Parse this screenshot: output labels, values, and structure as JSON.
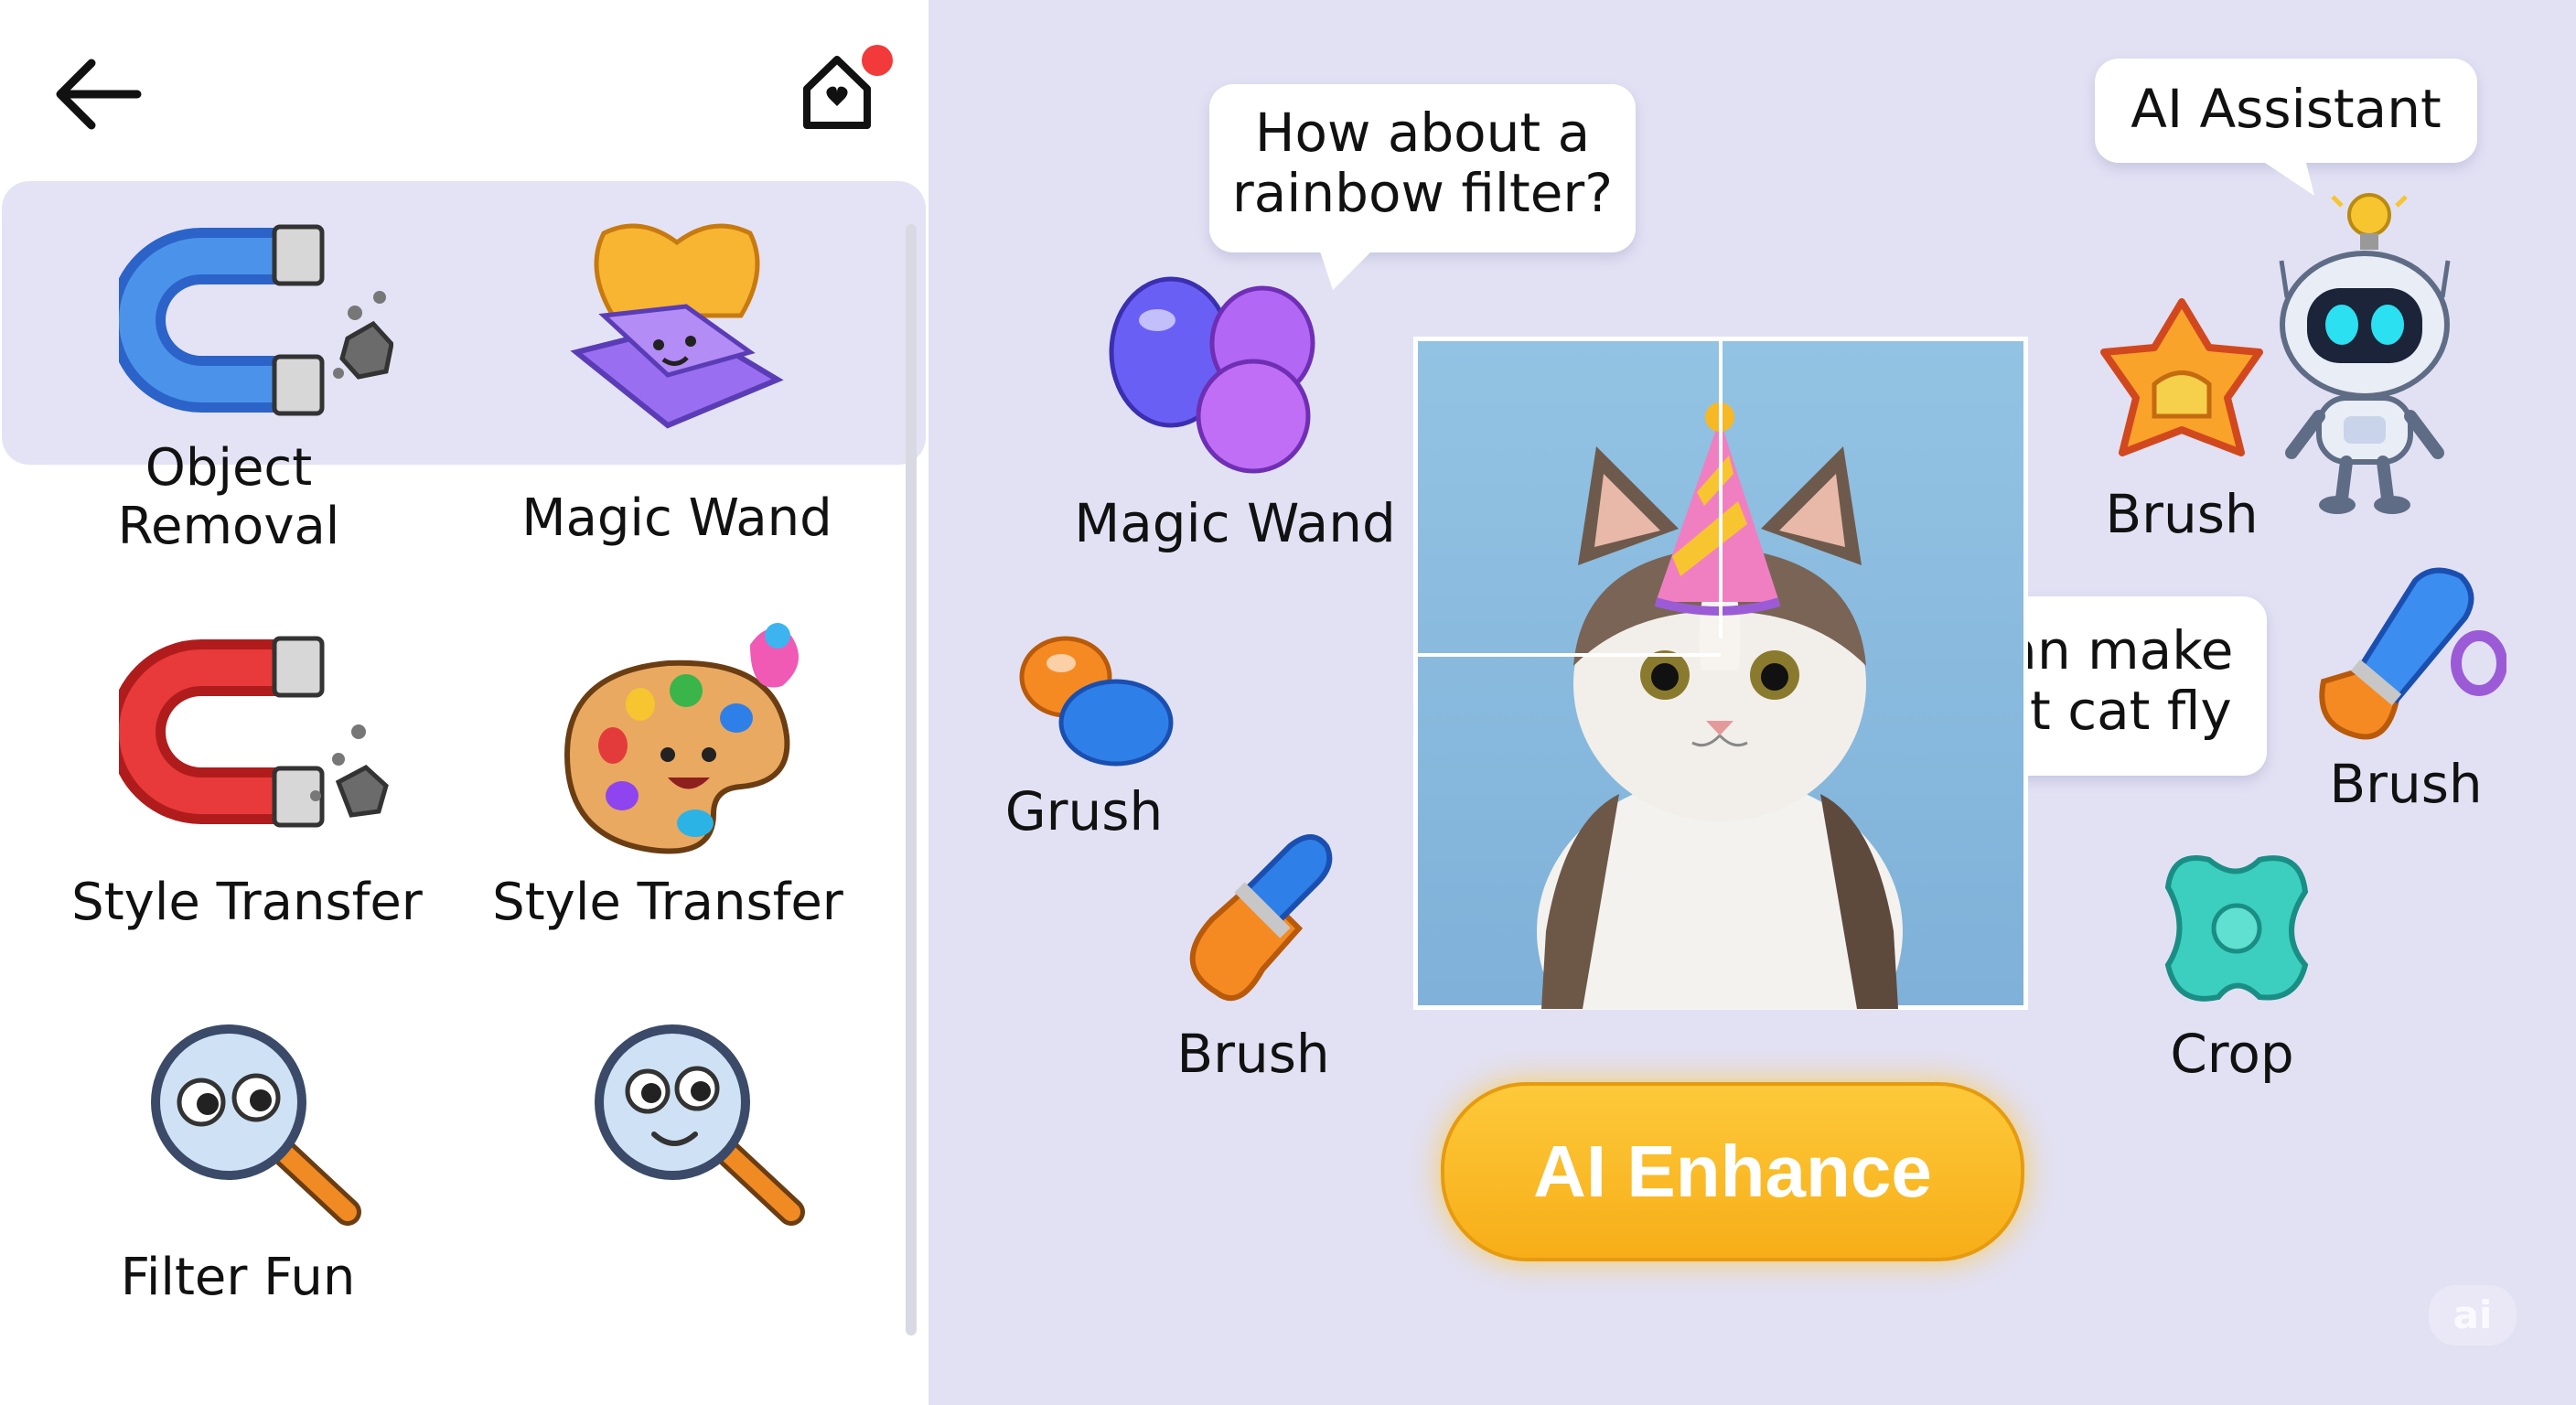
{
  "header": {
    "back_icon": "arrow-left-icon",
    "home_icon": "home-icon",
    "notification_color": "#f23a3a"
  },
  "sidebar": {
    "items": [
      {
        "label": "Object Removal",
        "icon": "magnet-icon"
      },
      {
        "label": "Magic Wand",
        "icon": "magic-book-icon"
      },
      {
        "label": "Style Transfer",
        "icon": "magnet-icon"
      },
      {
        "label": "Style Transfer",
        "icon": "paint-palette-icon"
      },
      {
        "label": "Filter Fun",
        "icon": "magnifier-icon"
      },
      {
        "label": "",
        "icon": "magnifier-icon"
      }
    ],
    "selected_index": 0
  },
  "canvas": {
    "bubbles": {
      "rainbow": "How about a\nrainbow filter?",
      "assistant": "AI Assistant",
      "fly": "I can make\nthat cat fly"
    },
    "tools": [
      {
        "label": "Magic Wand",
        "icon": "jelly-blob-icon"
      },
      {
        "label": "Grush",
        "icon": "jelly-grush-icon"
      },
      {
        "label": "Brush",
        "icon": "brush-icon"
      },
      {
        "label": "Brush",
        "icon": "star-jelly-icon"
      },
      {
        "label": "Brush",
        "icon": "brush-icon"
      },
      {
        "label": "Crop",
        "icon": "crop-jelly-icon"
      }
    ],
    "photo": "cat-with-party-hat-photo",
    "enhance_button": "AI Enhance",
    "watermark": "ai"
  },
  "colors": {
    "accent": "#f9b51d",
    "panel_bg": "#e2e1f4",
    "selection_bg": "#e4e3f5"
  }
}
